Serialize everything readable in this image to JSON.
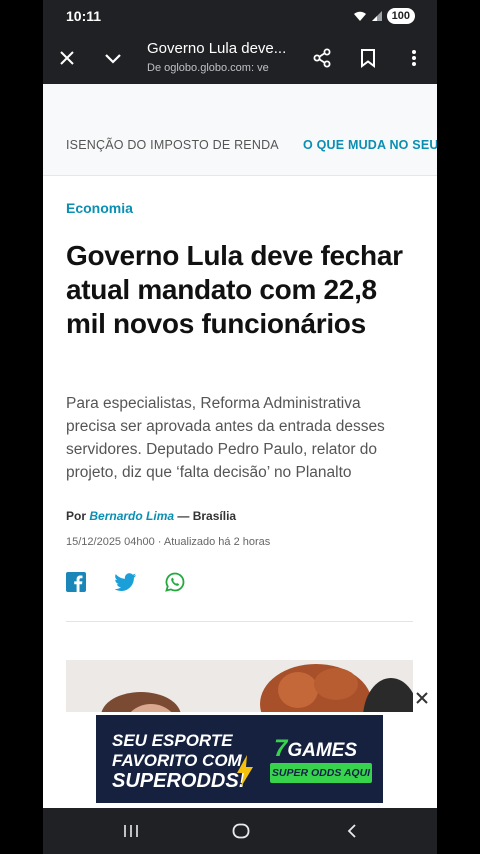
{
  "status_bar": {
    "time": "10:11",
    "battery": "100",
    "icons": [
      "wifi-icon",
      "signal-icon",
      "battery-icon"
    ]
  },
  "toolbar": {
    "close_icon": "close-icon",
    "menu_icon": "chevron-down-icon",
    "title": "Governo Lula deve...",
    "url": "De oglobo.globo.com: ve",
    "share_icon": "share-icon",
    "bookmark_icon": "bookmark-icon",
    "more_icon": "more-vert-icon"
  },
  "topics": [
    "ISENÇÃO DO IMPOSTO DE RENDA",
    "O QUE MUDA NO SEU"
  ],
  "article": {
    "kicker": "Economia",
    "headline": "Governo Lula deve fechar atual mandato com 22,8 mil novos funcionários",
    "subtitle": "Para especialistas, Reforma Administrativa precisa ser aprovada antes da entrada desses servidores. Deputado Pedro Paulo, relator do projeto, diz que ‘falta decisão’ no Planalto",
    "byline_prefix": "Por",
    "author": "Bernardo Lima",
    "location": "— Brasília",
    "dateline": "15/12/2025 04h00 · Atualizado há 2 horas",
    "share": [
      "facebook-icon",
      "twitter-icon",
      "whatsapp-icon"
    ]
  },
  "ad": {
    "line1": "SEU ESPORTE",
    "line2": "FAVORITO COM",
    "line3": "SUPERODDS!",
    "logo_seven": "7",
    "logo_text": "GAMES",
    "button": "SUPER ODDS AQUI"
  },
  "colors": {
    "accent": "#0a8fb3",
    "toolbar": "#202124",
    "ad_bg": "#16213f",
    "ad_green": "#37d34c"
  },
  "nav_bar": [
    "recents-icon",
    "home-icon",
    "back-icon"
  ]
}
